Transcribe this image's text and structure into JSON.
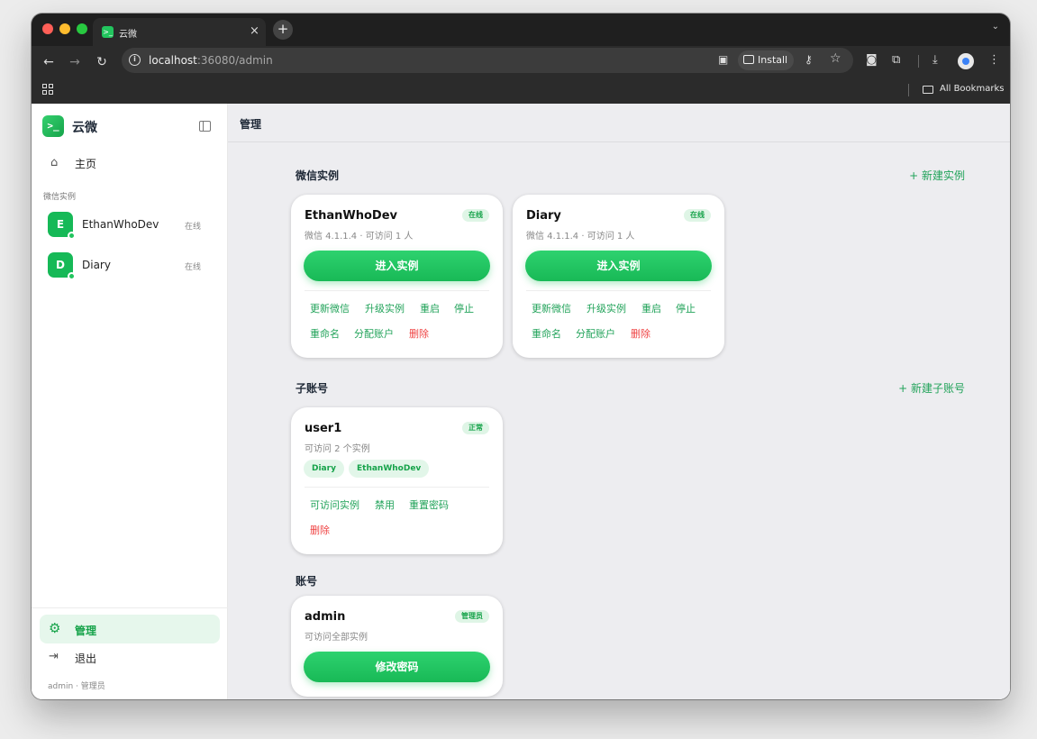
{
  "browser": {
    "tab_title": "云微",
    "tab_favicon": "terminal-icon",
    "url_host": "localhost",
    "url_path": ":36080/admin",
    "install_label": "Install",
    "bookmarks_label": "All Bookmarks"
  },
  "sidebar": {
    "app_name": "云微",
    "logo_glyph": ">_",
    "home_label": "主页",
    "instances_section": "微信实例",
    "instances": [
      {
        "initial": "E",
        "name": "EthanWhoDev",
        "status": "在线"
      },
      {
        "initial": "D",
        "name": "Diary",
        "status": "在线"
      }
    ],
    "manage_label": "管理",
    "logout_label": "退出",
    "user_meta": "admin · 管理员"
  },
  "main": {
    "title": "管理",
    "instances_section": {
      "title": "微信实例",
      "action": "+ 新建实例",
      "cards": [
        {
          "name": "EthanWhoDev",
          "badge": "在线",
          "sub": "微信 4.1.1.4 · 可访问 1 人",
          "primary": "进入实例",
          "actions_row1": [
            "更新微信",
            "升级实例",
            "重启",
            "停止"
          ],
          "actions_row2": [
            "重命名",
            "分配账户"
          ],
          "danger": "删除"
        },
        {
          "name": "Diary",
          "badge": "在线",
          "sub": "微信 4.1.1.4 · 可访问 1 人",
          "primary": "进入实例",
          "actions_row1": [
            "更新微信",
            "升级实例",
            "重启",
            "停止"
          ],
          "actions_row2": [
            "重命名",
            "分配账户"
          ],
          "danger": "删除"
        }
      ]
    },
    "subaccounts_section": {
      "title": "子账号",
      "action": "+ 新建子账号",
      "card": {
        "name": "user1",
        "badge": "正常",
        "sub": "可访问 2 个实例",
        "chips": [
          "Diary",
          "EthanWhoDev"
        ],
        "actions": [
          "可访问实例",
          "禁用",
          "重置密码"
        ],
        "danger": "删除"
      }
    },
    "account_section": {
      "title": "账号",
      "card": {
        "name": "admin",
        "badge": "管理员",
        "sub": "可访问全部实例",
        "primary": "修改密码"
      }
    }
  },
  "colors": {
    "accent": "#22c55e",
    "danger": "#ef4444",
    "active_bg": "#e6f7ec"
  }
}
